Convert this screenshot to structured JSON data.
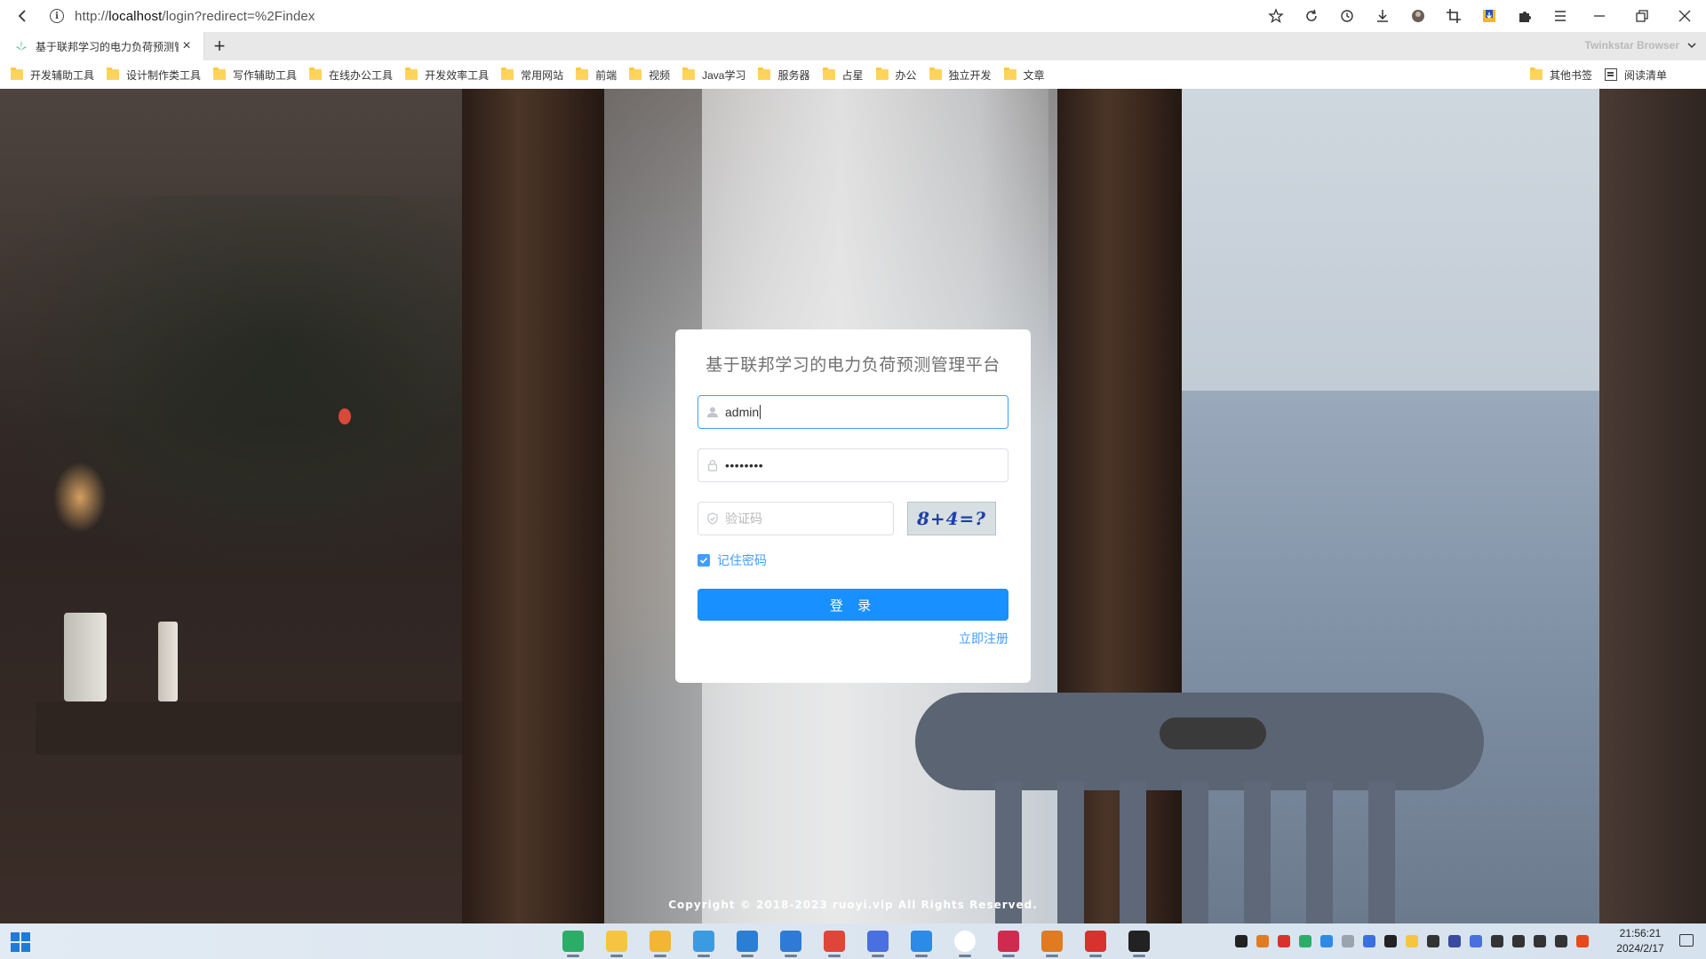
{
  "browser": {
    "url_prefix": "http://",
    "url_host": "localhost",
    "url_path": "/login?redirect=%2Findex",
    "tab_title": "基于联邦学习的电力负荷预测管",
    "brand": "Twinkstar Browser",
    "toolbar_icons": [
      "star-icon",
      "reload-icon",
      "history-icon",
      "download-icon",
      "avatar-icon",
      "crop-icon",
      "extension-download-icon",
      "puzzle-icon",
      "menu-icon"
    ]
  },
  "bookmarks": {
    "items": [
      {
        "label": "开发辅助工具"
      },
      {
        "label": "设计制作类工具"
      },
      {
        "label": "写作辅助工具"
      },
      {
        "label": "在线办公工具"
      },
      {
        "label": "开发效率工具"
      },
      {
        "label": "常用网站"
      },
      {
        "label": "前端"
      },
      {
        "label": "视频"
      },
      {
        "label": "Java学习"
      },
      {
        "label": "服务器"
      },
      {
        "label": "占星"
      },
      {
        "label": "办公"
      },
      {
        "label": "独立开发"
      },
      {
        "label": "文章"
      }
    ],
    "other": "其他书签",
    "reading_list": "阅读清单"
  },
  "login": {
    "title": "基于联邦学习的电力负荷预测管理平台",
    "username_value": "admin",
    "password_value": "••••••••",
    "captcha_placeholder": "验证码",
    "captcha_text": "8+4=?",
    "remember_label": "记住密码",
    "remember_checked": true,
    "login_button": "登 录",
    "register_link": "立即注册"
  },
  "footer": {
    "copyright": "Copyright © 2018-2023 ruoyi.vip All Rights Reserved."
  },
  "taskbar": {
    "time": "21:56:21",
    "date": "2024/2/17",
    "apps": [
      {
        "name": "wechat-icon",
        "color": "#2aae67"
      },
      {
        "name": "folder-smile-icon",
        "color": "#f5c542"
      },
      {
        "name": "file-explorer-icon",
        "color": "#f2b632"
      },
      {
        "name": "edge-icon",
        "color": "#3b9be0"
      },
      {
        "name": "vscode-icon",
        "color": "#2a7fd4"
      },
      {
        "name": "typora-icon",
        "color": "#2e7ad6"
      },
      {
        "name": "chrome-icon",
        "color": "#e0453a"
      },
      {
        "name": "app-share-icon",
        "color": "#4a6fe0"
      },
      {
        "name": "photos-icon",
        "color": "#2c8be6"
      },
      {
        "name": "circle-app-icon",
        "color": "#ffffff"
      },
      {
        "name": "intellij-icon",
        "color": "#cf2b4f"
      },
      {
        "name": "search-tool-icon",
        "color": "#e07b22"
      },
      {
        "name": "wps-icon",
        "color": "#d8322e"
      },
      {
        "name": "recorder-icon",
        "color": "#222222"
      }
    ],
    "tray": [
      {
        "name": "qq-icon",
        "color": "#222"
      },
      {
        "name": "search-tray-icon",
        "color": "#e07b22"
      },
      {
        "name": "record-tray-icon",
        "color": "#d8322e"
      },
      {
        "name": "wechat-tray-icon",
        "color": "#2aae67"
      },
      {
        "name": "photos-tray-icon",
        "color": "#2c8be6"
      },
      {
        "name": "app-tray-icon",
        "color": "#9aa4ae"
      },
      {
        "name": "feishu-tray-icon",
        "color": "#3a6fe0"
      },
      {
        "name": "notion-tray-icon",
        "color": "#222"
      },
      {
        "name": "folder-tray-icon",
        "color": "#f5c542"
      },
      {
        "name": "game-tray-icon",
        "color": "#333"
      },
      {
        "name": "chat-tray-icon",
        "color": "#3a4aa0"
      },
      {
        "name": "sync-tray-icon",
        "color": "#4a6fe0"
      },
      {
        "name": "mic-icon",
        "color": "#333"
      },
      {
        "name": "wifi-icon",
        "color": "#333"
      },
      {
        "name": "volume-icon",
        "color": "#333"
      },
      {
        "name": "ime-icon",
        "color": "#333"
      },
      {
        "name": "sogou-icon",
        "color": "#e64a19"
      }
    ]
  },
  "colors": {
    "accent": "#409eff",
    "login_button": "#1890ff"
  }
}
